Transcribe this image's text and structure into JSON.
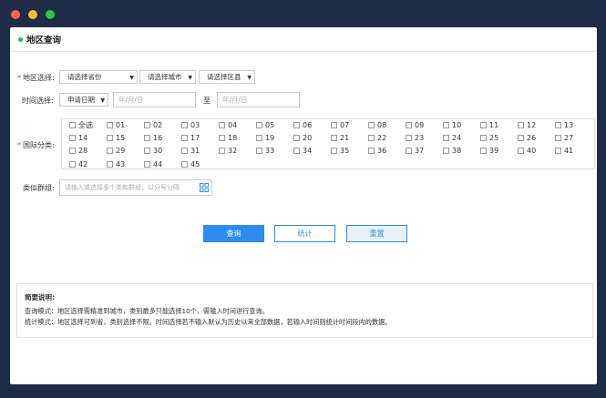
{
  "colors": {
    "accent": "#2d8cf0",
    "title_dot": "#19be6b",
    "required": "#e33333"
  },
  "page": {
    "title": "地区查询"
  },
  "region": {
    "label": "地区选择:",
    "province": "请选择省份",
    "city": "请选择城市",
    "county": "请选择区县"
  },
  "time": {
    "label": "时间选择:",
    "type": "申请日期",
    "start_placeholder": "年/月/日",
    "to": "至",
    "end_placeholder": "年/月/日"
  },
  "category": {
    "label": "国际分类:",
    "options": [
      "全选",
      "01",
      "02",
      "03",
      "04",
      "05",
      "06",
      "07",
      "08",
      "09",
      "10",
      "11",
      "12",
      "13",
      "14",
      "15",
      "16",
      "17",
      "18",
      "19",
      "20",
      "21",
      "22",
      "23",
      "24",
      "25",
      "26",
      "27",
      "28",
      "29",
      "30",
      "31",
      "32",
      "33",
      "34",
      "35",
      "36",
      "37",
      "38",
      "39",
      "40",
      "41",
      "42",
      "43",
      "44",
      "45"
    ]
  },
  "group": {
    "label": "类似群组:",
    "placeholder": "请输入或选择多个类和群组，以分号分隔"
  },
  "buttons": {
    "query": "查询",
    "stats": "统计",
    "reset": "重置"
  },
  "notes": {
    "title": "简要说明:",
    "lines": [
      "查询模式：地区选择需精准到城市，类别最多只能选择10个，需输入时间进行查询。",
      "统计模式：地区选择可到省，类别选择不限。时间选择若不输入默认为历史以来全部数据，若输入时间则统计时间段内的数据。"
    ]
  }
}
